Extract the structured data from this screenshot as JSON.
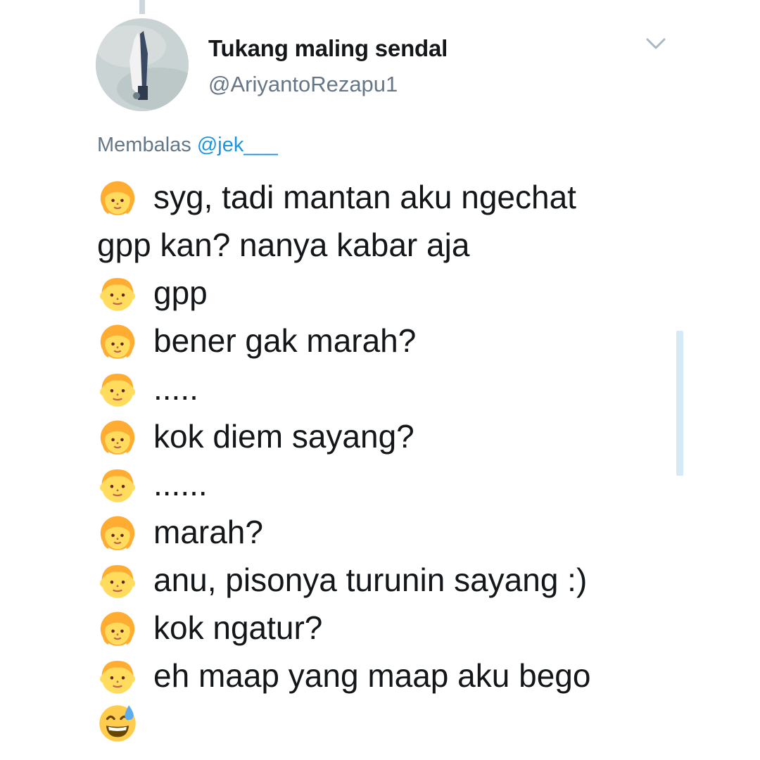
{
  "tweet": {
    "display_name": "Tukang maling sendal",
    "handle": "@AriyantoRezapu1",
    "reply_prefix": "Membalas",
    "reply_mention": "@jek___",
    "lines": [
      {
        "emoji": "woman-emoji",
        "text": "syg, tadi mantan aku ngechat"
      },
      {
        "emoji": "",
        "text": "gpp kan? nanya kabar aja"
      },
      {
        "emoji": "man-emoji",
        "text": "gpp"
      },
      {
        "emoji": "woman-emoji",
        "text": "bener gak marah?"
      },
      {
        "emoji": "man-emoji",
        "text": "....."
      },
      {
        "emoji": "woman-emoji",
        "text": "kok diem sayang?"
      },
      {
        "emoji": "man-emoji",
        "text": "......"
      },
      {
        "emoji": "woman-emoji",
        "text": "marah?"
      },
      {
        "emoji": "man-emoji",
        "text": "anu, pisonya turunin sayang :)"
      },
      {
        "emoji": "woman-emoji",
        "text": "kok ngatur?"
      },
      {
        "emoji": "man-emoji",
        "text": "eh maap yang maap aku bego"
      },
      {
        "emoji": "grinning-sweat-emoji",
        "text": ""
      }
    ]
  },
  "icons": {
    "caret": "chevron-down-icon",
    "avatar": "profile-avatar"
  },
  "colors": {
    "secondary_text": "#657786",
    "link": "#1b95e0",
    "emoji_skin": "#ffcc4d",
    "emoji_hair": "#f5a623"
  }
}
